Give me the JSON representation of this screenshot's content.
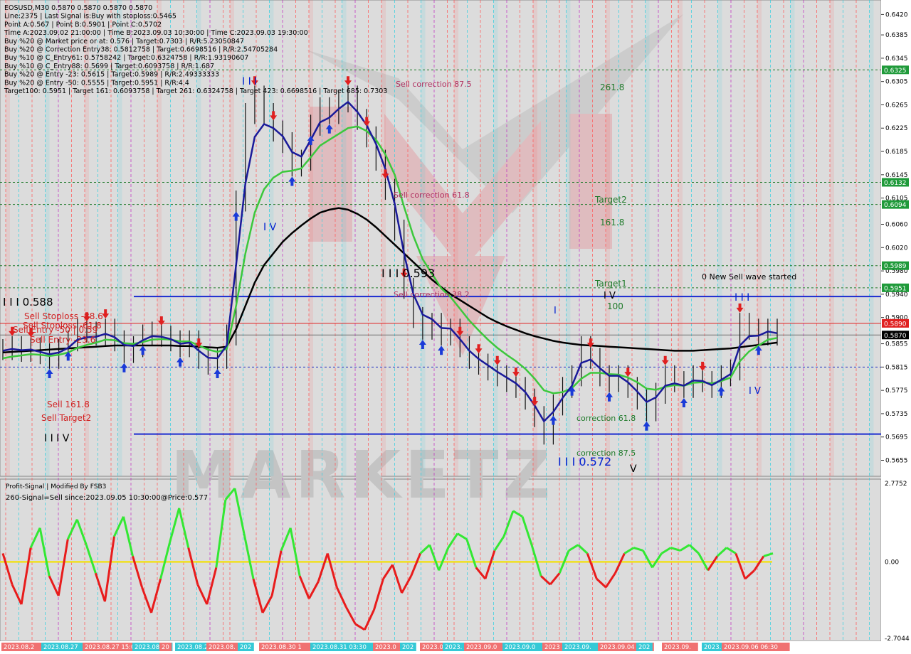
{
  "info_lines": [
    "EOSUSD,M30  0.5870 0.5870 0.5870 0.5870",
    "Line:2375 | Last Signal is:Buy with stoploss:0.5465",
    "Point A:0.567 | Point B:0.5901 | Point C:0.5702",
    "Time A:2023.09.02 21:00:00 | Time B:2023.09.03 10:30:00 | Time C:2023.09.03 19:30:00",
    "Buy %20 @ Market price or at: 0.576 | Target:0.7303 | R/R:5.23050847",
    "Buy %20 @ Correction Entry38: 0.5812758 | Target:0.6698516 | R/R:2.54705284",
    "Buy %10 @ C_Entry61: 0.5758242 | Target:0.6324758 | R/R:1.93190607",
    "Buy %10 @ C_Entry88: 0.5699 | Target:0.6093758 | R/R:1.687",
    "Buy %20 @ Entry -23: 0.5615 | Target:0.5989 | R/R:2.49333333",
    "Buy %20 @ Entry -50: 0.5555 | Target:0.5951 | R/R:4.4",
    "Target100: 0.5951 | Target 161: 0.6093758 | Target 261: 0.6324758 | Target 423: 0.6698516 | Target 685: 0.7303"
  ],
  "price_axis": [
    "0.6420",
    "0.6385",
    "0.6345",
    "0.6305",
    "0.6265",
    "0.6225",
    "0.6185",
    "0.6145",
    "0.6105",
    "0.6060",
    "0.6020",
    "0.5980",
    "0.5940",
    "0.5900",
    "0.5855",
    "0.5815",
    "0.5775",
    "0.5735",
    "0.5695",
    "0.5655"
  ],
  "price_tags": [
    {
      "value": "0.6325",
      "color": "#1f9a3a"
    },
    {
      "value": "0.6132",
      "color": "#1f9a3a"
    },
    {
      "value": "0.6094",
      "color": "#1f9a3a"
    },
    {
      "value": "0.5989",
      "color": "#1f9a3a"
    },
    {
      "value": "0.5951",
      "color": "#1f9a3a"
    },
    {
      "value": "0.5890",
      "color": "#e02020"
    },
    {
      "value": "0.5870",
      "color": "#000000"
    }
  ],
  "annotations": [
    {
      "text": "Sell correction 87.5",
      "color": "#b03060"
    },
    {
      "text": "261.8",
      "color": "#1f7a2a"
    },
    {
      "text": "Sell correction 61.8",
      "color": "#b03060"
    },
    {
      "text": "Target2",
      "color": "#1f7a2a"
    },
    {
      "text": "161.8",
      "color": "#1f7a2a"
    },
    {
      "text": "0 New Sell wave started",
      "color": "#000000"
    },
    {
      "text": "Target1",
      "color": "#1f7a2a"
    },
    {
      "text": "I V",
      "color": "#000000"
    },
    {
      "text": "100",
      "color": "#1f7a2a"
    },
    {
      "text": "Sell correction 38.2",
      "color": "#b03060"
    },
    {
      "text": "I I I",
      "color": "#0020d0"
    },
    {
      "text": "I I I 0.593",
      "color": "#000000"
    },
    {
      "text": "I I I 0.588",
      "color": "#000000"
    },
    {
      "text": "Sell Stoploss -88.6",
      "color": "#d02020"
    },
    {
      "text": "Sell Stoploss -61.8",
      "color": "#d02020"
    },
    {
      "text": "Sell Entry -50 | 0.59",
      "color": "#d02020"
    },
    {
      "text": "Sell Entry -23.6",
      "color": "#d02020"
    },
    {
      "text": "Sell 161.8",
      "color": "#d02020"
    },
    {
      "text": "Sell Target2",
      "color": "#d02020"
    },
    {
      "text": "I I I V",
      "color": "#000000"
    },
    {
      "text": "correction 61.8",
      "color": "#1f7a2a"
    },
    {
      "text": "correction 87.5",
      "color": "#1f7a2a"
    },
    {
      "text": "I I I 0.572",
      "color": "#0020d0"
    },
    {
      "text": "V",
      "color": "#000000"
    },
    {
      "text": "I V",
      "color": "#0020d0"
    },
    {
      "text": "I V",
      "color": "#0020d0"
    },
    {
      "text": "I",
      "color": "#0020d0"
    },
    {
      "text": "I I I",
      "color": "#0020d0"
    }
  ],
  "indicator": {
    "title": "Profit-Signal | Modified By FSB3",
    "signal_text": "260-Signal=Sell since:2023.09.05 10:30:00@Price:0.577",
    "axis": [
      "2.7752",
      "0.00",
      "-2.7044"
    ]
  },
  "time_labels": [
    "2023.08.2",
    "2023.08.27",
    "2023.08.27 15:0",
    "2023.08.2",
    "20",
    "2023.08.2",
    "2023.08.",
    "202",
    "2023.08.30 1",
    "2023.08.31 03:30",
    "2023.0",
    "202",
    "2023.09",
    "2023.",
    "2023.09.0",
    "2023.09.0",
    "2023",
    "2023.09.",
    "2023.09.04 08",
    "202",
    "2023.09.",
    "2023.09.0",
    "2023.09.06 06:30"
  ],
  "chart_data": {
    "type": "line",
    "symbol": "EOSUSD",
    "timeframe": "M30",
    "ylim": [
      0.563,
      0.644
    ],
    "price_close": [
      0.5845,
      0.585,
      0.5842,
      0.5848,
      0.5838,
      0.583,
      0.5845,
      0.586,
      0.588,
      0.5875,
      0.587,
      0.588,
      0.586,
      0.584,
      0.585,
      0.587,
      0.5875,
      0.5868,
      0.586,
      0.585,
      0.586,
      0.583,
      0.582,
      0.583,
      0.587,
      0.61,
      0.625,
      0.628,
      0.625,
      0.622,
      0.62,
      0.616,
      0.617,
      0.623,
      0.626,
      0.625,
      0.627,
      0.628,
      0.624,
      0.621,
      0.617,
      0.612,
      0.605,
      0.595,
      0.59,
      0.588,
      0.589,
      0.587,
      0.588,
      0.585,
      0.583,
      0.582,
      0.581,
      0.58,
      0.579,
      0.578,
      0.576,
      0.573,
      0.57,
      0.575,
      0.578,
      0.58,
      0.585,
      0.583,
      0.58,
      0.579,
      0.58,
      0.578,
      0.576,
      0.574,
      0.577,
      0.58,
      0.579,
      0.578,
      0.58,
      0.579,
      0.578,
      0.58,
      0.581,
      0.589,
      0.588,
      0.587,
      0.588,
      0.587
    ],
    "ma_blue": [
      0.5843,
      0.5846,
      0.5844,
      0.5845,
      0.5841,
      0.5837,
      0.584,
      0.5848,
      0.5862,
      0.5866,
      0.5867,
      0.5872,
      0.5866,
      0.5853,
      0.5851,
      0.5861,
      0.5868,
      0.5867,
      0.5863,
      0.5855,
      0.5857,
      0.5843,
      0.5831,
      0.583,
      0.5852,
      0.599,
      0.613,
      0.621,
      0.6232,
      0.6225,
      0.6211,
      0.6184,
      0.6176,
      0.6205,
      0.6235,
      0.6243,
      0.6258,
      0.627,
      0.6253,
      0.623,
      0.6198,
      0.6155,
      0.6095,
      0.601,
      0.594,
      0.5905,
      0.5897,
      0.5882,
      0.5881,
      0.5863,
      0.5843,
      0.5829,
      0.5818,
      0.5807,
      0.5797,
      0.5787,
      0.5772,
      0.5749,
      0.5722,
      0.5738,
      0.5762,
      0.5783,
      0.5822,
      0.5828,
      0.5813,
      0.58,
      0.58,
      0.5789,
      0.5773,
      0.5755,
      0.5763,
      0.5783,
      0.5787,
      0.5783,
      0.5792,
      0.5791,
      0.5784,
      0.5793,
      0.5803,
      0.5852,
      0.5868,
      0.5869,
      0.5876,
      0.5873
    ],
    "ma_green": [
      0.583,
      0.5833,
      0.5835,
      0.5837,
      0.5836,
      0.5834,
      0.5836,
      0.584,
      0.5848,
      0.5853,
      0.5857,
      0.5862,
      0.5861,
      0.5856,
      0.5855,
      0.5858,
      0.5862,
      0.5863,
      0.5862,
      0.5859,
      0.5859,
      0.5852,
      0.5845,
      0.5841,
      0.5846,
      0.592,
      0.601,
      0.608,
      0.612,
      0.614,
      0.615,
      0.6152,
      0.6156,
      0.6175,
      0.6195,
      0.6205,
      0.6215,
      0.6225,
      0.6228,
      0.622,
      0.6205,
      0.618,
      0.6145,
      0.609,
      0.604,
      0.6,
      0.5975,
      0.595,
      0.5935,
      0.5915,
      0.5895,
      0.5878,
      0.5862,
      0.5848,
      0.5836,
      0.5825,
      0.5812,
      0.5795,
      0.5775,
      0.577,
      0.5772,
      0.5779,
      0.5795,
      0.5805,
      0.5805,
      0.5803,
      0.5802,
      0.5797,
      0.5789,
      0.5778,
      0.5776,
      0.5781,
      0.5784,
      0.5783,
      0.5788,
      0.5789,
      0.5787,
      0.5791,
      0.5797,
      0.5825,
      0.5842,
      0.5852,
      0.5862,
      0.5865
    ],
    "ma_black": [
      0.584,
      0.5841,
      0.5842,
      0.5843,
      0.5844,
      0.5845,
      0.5846,
      0.5847,
      0.5848,
      0.5849,
      0.585,
      0.5851,
      0.5852,
      0.5852,
      0.5852,
      0.5852,
      0.5852,
      0.5852,
      0.5852,
      0.5851,
      0.5851,
      0.585,
      0.5849,
      0.5848,
      0.585,
      0.588,
      0.592,
      0.596,
      0.599,
      0.601,
      0.603,
      0.6045,
      0.6058,
      0.607,
      0.608,
      0.6085,
      0.6088,
      0.6085,
      0.6078,
      0.6068,
      0.6055,
      0.604,
      0.6025,
      0.601,
      0.5995,
      0.598,
      0.5965,
      0.5952,
      0.594,
      0.593,
      0.592,
      0.591,
      0.59,
      0.5892,
      0.5885,
      0.5879,
      0.5873,
      0.5868,
      0.5864,
      0.586,
      0.5857,
      0.5855,
      0.5853,
      0.5852,
      0.5851,
      0.585,
      0.5849,
      0.5848,
      0.5847,
      0.5846,
      0.5845,
      0.5844,
      0.5843,
      0.5843,
      0.5843,
      0.5844,
      0.5845,
      0.5846,
      0.5847,
      0.5849,
      0.5851,
      0.5853,
      0.5855,
      0.5857
    ],
    "indicator_values": [
      0.3,
      -0.8,
      -1.5,
      0.5,
      1.2,
      -0.5,
      -1.2,
      0.8,
      1.5,
      0.6,
      -0.4,
      -1.4,
      0.9,
      1.6,
      0.2,
      -0.9,
      -1.8,
      -0.6,
      0.7,
      1.9,
      0.5,
      -0.8,
      -1.5,
      -0.2,
      2.2,
      2.6,
      1.0,
      -0.6,
      -1.8,
      -1.2,
      0.4,
      1.2,
      -0.5,
      -1.3,
      -0.7,
      0.3,
      -0.9,
      -1.6,
      -2.2,
      -2.4,
      -1.7,
      -0.6,
      -0.1,
      -1.1,
      -0.5,
      0.3,
      0.6,
      -0.3,
      0.5,
      1.0,
      0.8,
      -0.2,
      -0.6,
      0.4,
      0.9,
      1.8,
      1.6,
      0.6,
      -0.5,
      -0.8,
      -0.4,
      0.4,
      0.6,
      0.3,
      -0.6,
      -0.9,
      -0.4,
      0.3,
      0.5,
      0.4,
      -0.2,
      0.3,
      0.5,
      0.4,
      0.6,
      0.3,
      -0.3,
      0.2,
      0.5,
      0.3,
      -0.6,
      -0.3,
      0.2,
      0.3
    ]
  }
}
